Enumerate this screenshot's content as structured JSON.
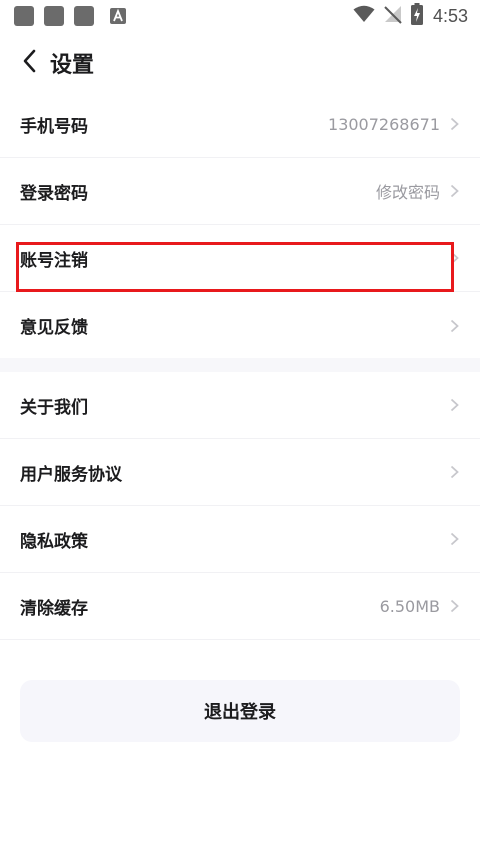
{
  "status_bar": {
    "time": "4:53",
    "left_icons": [
      "notification-square-icon",
      "notification-square-icon",
      "notification-square-icon",
      "a-app-icon"
    ],
    "right_icons": [
      "wifi-icon",
      "no-signal-icon",
      "battery-charging-icon"
    ]
  },
  "header": {
    "back_icon": "chevron-left-icon",
    "title": "设置"
  },
  "account_section": [
    {
      "label": "手机号码",
      "value": "13007268671"
    },
    {
      "label": "登录密码",
      "value": "修改密码"
    },
    {
      "label": "账号注销",
      "value": ""
    },
    {
      "label": "意见反馈",
      "value": ""
    }
  ],
  "info_section": [
    {
      "label": "关于我们",
      "value": ""
    },
    {
      "label": "用户服务协议",
      "value": ""
    },
    {
      "label": "隐私政策",
      "value": ""
    },
    {
      "label": "清除缓存",
      "value": "6.50MB"
    }
  ],
  "logout_label": "退出登录",
  "colors": {
    "highlight": "#e8191c",
    "logout_bg": "#f6f6fb",
    "secondary_text": "#9a9aa0"
  }
}
